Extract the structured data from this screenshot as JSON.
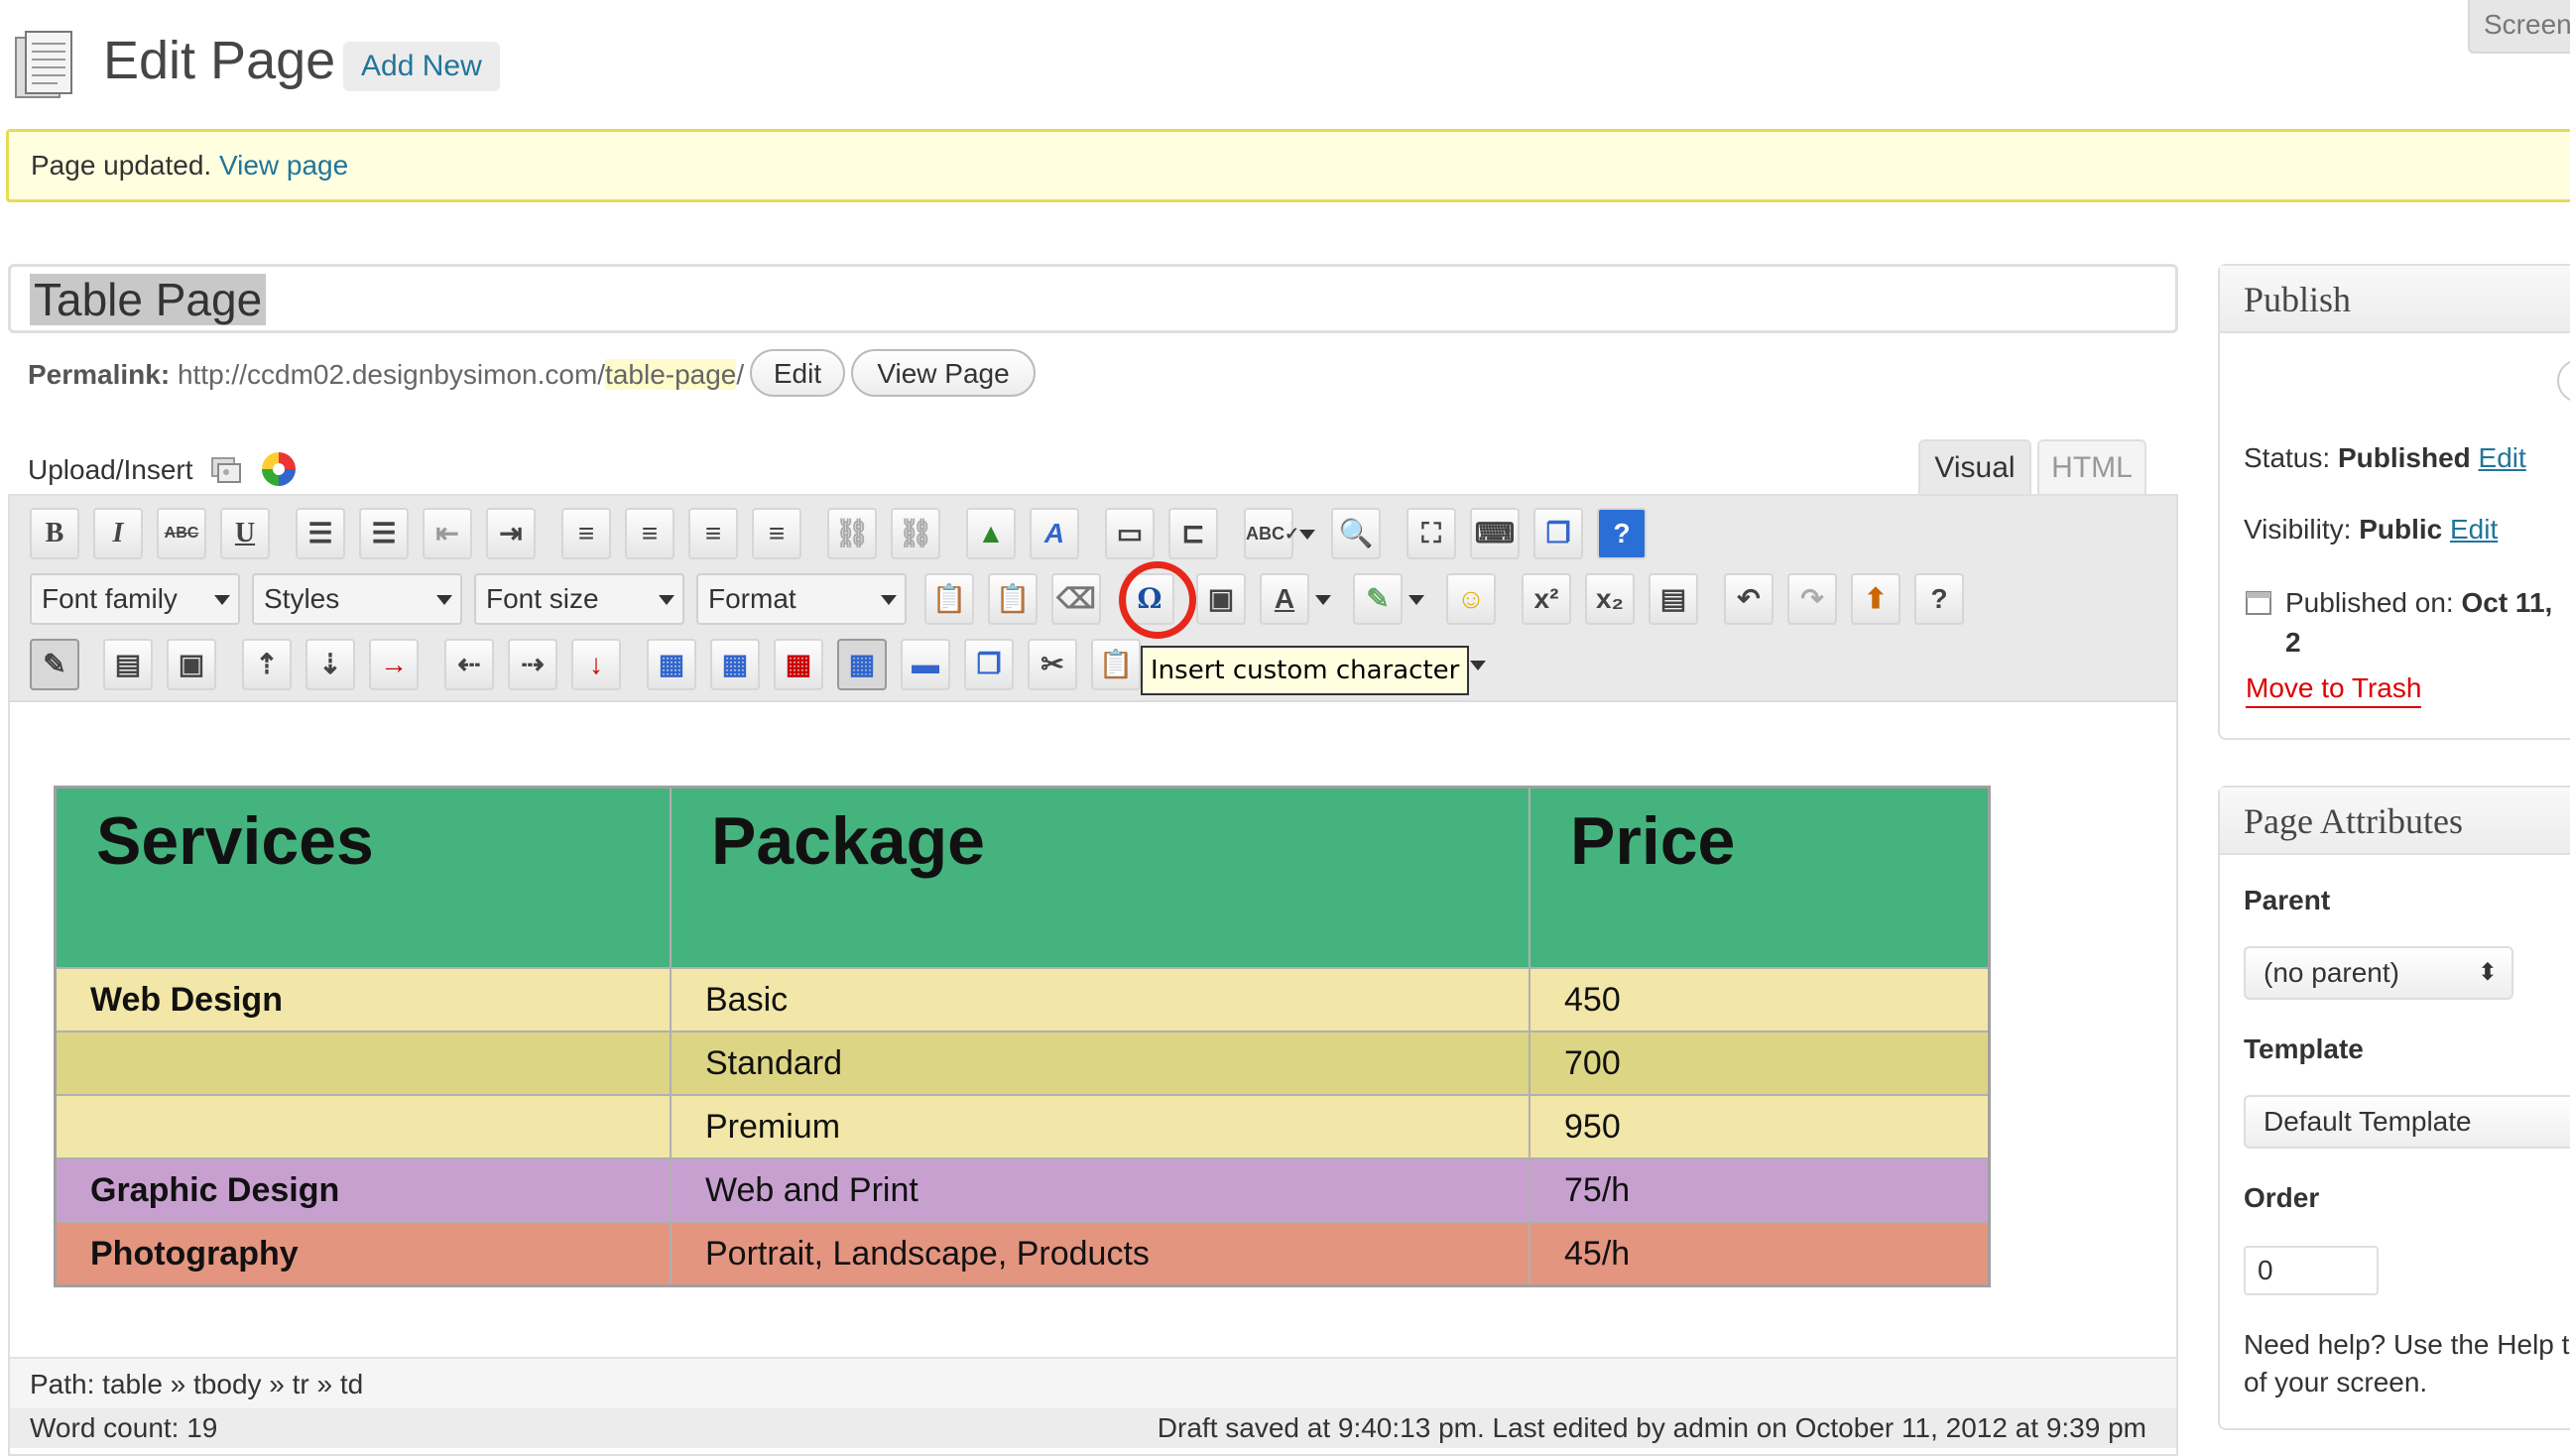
{
  "header": {
    "title": "Edit Page",
    "add_new": "Add New",
    "screen_options": "Screen"
  },
  "notice": {
    "text": "Page updated.",
    "link": "View page"
  },
  "post": {
    "title": "Table Page",
    "permalink_label": "Permalink:",
    "permalink_base": "http://ccdm02.designbysimon.com/",
    "permalink_slug": "table-page",
    "permalink_end": "/",
    "edit_button": "Edit",
    "view_button": "View Page"
  },
  "editor": {
    "upload_label": "Upload/Insert",
    "tabs": {
      "visual": "Visual",
      "html": "HTML"
    },
    "toolbar_row2": {
      "font_family": "Font family",
      "styles": "Styles",
      "font_size": "Font size",
      "format": "Format"
    },
    "tooltip": "Insert custom character",
    "table": {
      "headers": [
        "Services",
        "Package",
        "Price"
      ],
      "rows": [
        {
          "service": "Web Design",
          "package": "Basic",
          "price": "450",
          "color": "#f2e6a8"
        },
        {
          "service": "",
          "package": "Standard",
          "price": "700",
          "color": "#dcd684"
        },
        {
          "service": "",
          "package": "Premium",
          "price": "950",
          "color": "#f2e6a8"
        },
        {
          "service": "Graphic Design",
          "package": "Web and Print",
          "price": "75/h",
          "color": "#c8a0d0"
        },
        {
          "service": "Photography",
          "package": "Portrait, Landscape, Products",
          "price": "45/h",
          "color": "#e49580"
        }
      ],
      "header_color": "#45b37e"
    },
    "path_label": "Path:",
    "path": "table » tbody » tr » td",
    "word_count": "Word count: 19",
    "draft_status": "Draft saved at 9:40:13 pm. Last edited by admin on October 11, 2012 at 9:39 pm"
  },
  "publish": {
    "title": "Publish",
    "status_label": "Status:",
    "status_value": "Published",
    "visibility_label": "Visibility:",
    "visibility_value": "Public",
    "edit": "Edit",
    "published_on_label": "Published on:",
    "published_on_value": "Oct 11, 2",
    "trash": "Move to Trash"
  },
  "attributes": {
    "title": "Page Attributes",
    "parent_label": "Parent",
    "parent_value": "(no parent)",
    "template_label": "Template",
    "template_value": "Default Template",
    "order_label": "Order",
    "order_value": "0",
    "help": "Need help? Use the Help t",
    "help2": "of your screen."
  }
}
